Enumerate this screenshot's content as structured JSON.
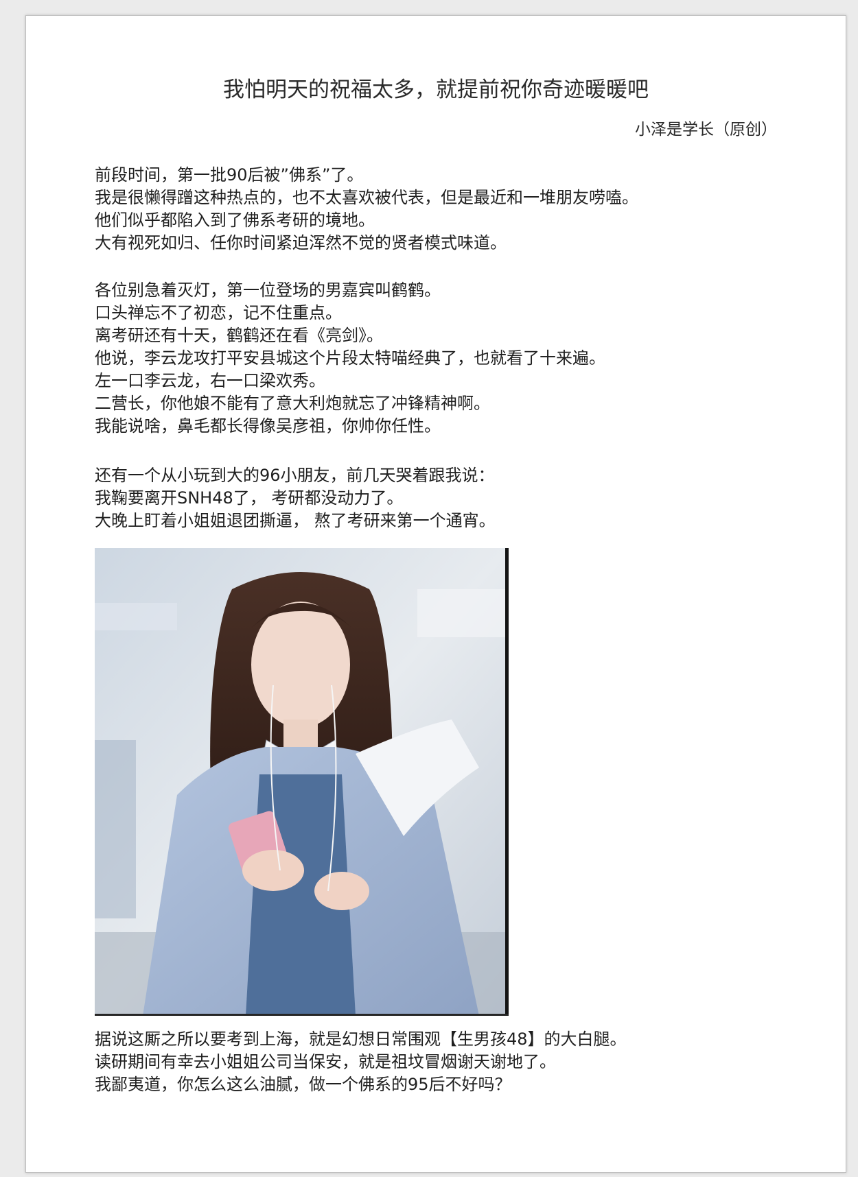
{
  "document": {
    "title": "我怕明天的祝福太多，就提前祝你奇迹暖暖吧",
    "author": "小泽是学长（原创）",
    "paragraphs": [
      [
        "前段时间，第一批90后被”佛系”了。",
        "我是很懒得蹭这种热点的，也不太喜欢被代表，但是最近和一堆朋友唠嗑。",
        "他们似乎都陷入到了佛系考研的境地。",
        "大有视死如归、任你时间紧迫浑然不觉的贤者模式味道。"
      ],
      [
        "各位别急着灭灯，第一位登场的男嘉宾叫鹤鹤。",
        "口头禅忘不了初恋，记不住重点。",
        "离考研还有十天，鹤鹤还在看《亮剑》。",
        "他说，李云龙攻打平安县城这个片段太特喵经典了，也就看了十来遍。",
        "左一口李云龙，右一口梁欢秀。",
        "二营长，你他娘不能有了意大利炮就忘了冲锋精神啊。",
        "我能说啥，鼻毛都长得像吴彦祖，你帅你任性。"
      ],
      [
        "还有一个从小玩到大的96小朋友，前几天哭着跟我说：",
        "我鞠要离开SNH48了， 考研都没动力了。",
        "大晚上盯着小姐姐退团撕逼， 熬了考研来第一个通宵。"
      ],
      [
        "据说这厮之所以要考到上海，就是幻想日常围观【生男孩48】的大白腿。",
        "读研期间有幸去小姐姐公司当保安，就是祖坟冒烟谢天谢地了。",
        "我鄙夷道，你怎么这么油腻，做一个佛系的95后不好吗？"
      ]
    ]
  }
}
